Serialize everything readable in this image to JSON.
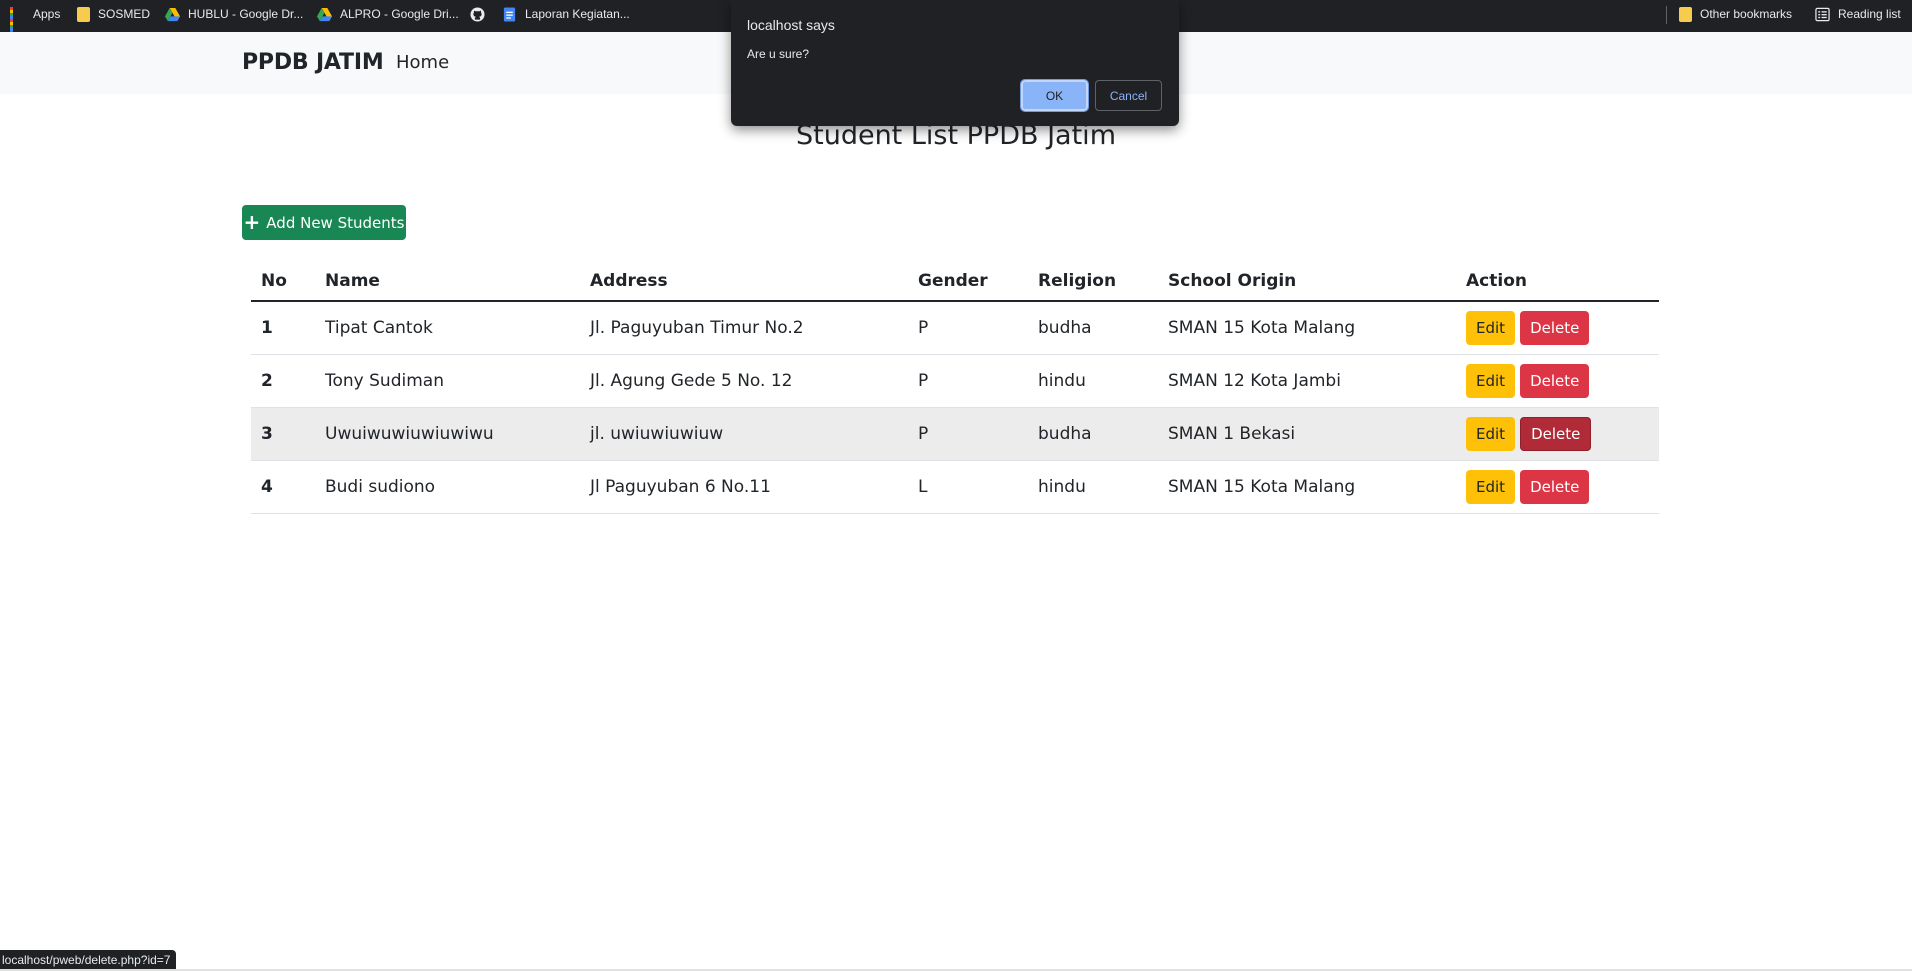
{
  "bookmarks": {
    "items": [
      {
        "label": "Apps",
        "icon": "apps-grid-icon"
      },
      {
        "label": "SOSMED",
        "icon": "folder-icon"
      },
      {
        "label": "HUBLU - Google Dr...",
        "icon": "google-drive-icon"
      },
      {
        "label": "ALPRO - Google Dri...",
        "icon": "google-drive-icon"
      },
      {
        "label": "",
        "icon": "github-icon"
      },
      {
        "label": "Laporan Kegiatan...",
        "icon": "google-docs-icon"
      }
    ],
    "right_items": [
      {
        "label": "Other bookmarks",
        "icon": "folder-icon"
      },
      {
        "label": "Reading list",
        "icon": "reading-list-icon"
      }
    ]
  },
  "navbar": {
    "brand": "PPDB JATIM",
    "home": "Home"
  },
  "page": {
    "title": "Student List PPDB Jatim",
    "add_button": "Add New Students"
  },
  "table": {
    "headers": [
      "No",
      "Name",
      "Address",
      "Gender",
      "Religion",
      "School Origin",
      "Action"
    ],
    "rows": [
      {
        "no": "1",
        "name": "Tipat Cantok",
        "address": "Jl. Paguyuban Timur No.2",
        "gender": "P",
        "religion": "budha",
        "school": "SMAN 15 Kota Malang"
      },
      {
        "no": "2",
        "name": "Tony Sudiman",
        "address": "Jl. Agung Gede 5 No. 12",
        "gender": "P",
        "religion": "hindu",
        "school": "SMAN 12 Kota Jambi"
      },
      {
        "no": "3",
        "name": "Uwuiwuwiuwiuwiwu",
        "address": "jl. uwiuwiuwiuw",
        "gender": "P",
        "religion": "budha",
        "school": "SMAN 1 Bekasi"
      },
      {
        "no": "4",
        "name": "Budi sudiono",
        "address": "Jl Paguyuban 6 No.11",
        "gender": "L",
        "religion": "hindu",
        "school": "SMAN 15 Kota Malang"
      }
    ],
    "edit_label": "Edit",
    "delete_label": "Delete"
  },
  "dialog": {
    "title": "localhost says",
    "message": "Are u sure?",
    "ok": "OK",
    "cancel": "Cancel"
  },
  "status": {
    "url": "localhost/pweb/delete.php?id=7"
  },
  "colors": {
    "navbar_bg": "#f8f9fa",
    "success": "#198754",
    "warning": "#ffc107",
    "danger": "#dc3545",
    "dialog_bg": "#202124",
    "dialog_accent": "#8ab4f8"
  }
}
